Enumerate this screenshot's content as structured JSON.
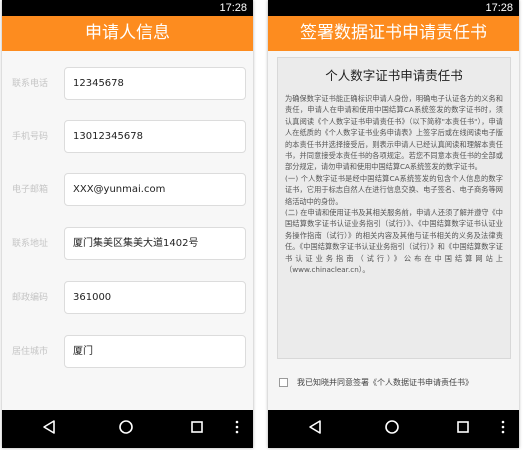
{
  "colors": {
    "accent": "#fd8c1f",
    "status_bar": "#000000",
    "nav_bar": "#000000"
  },
  "left_screen": {
    "status_time": "17:28",
    "title": "申请人信息",
    "fields": [
      {
        "label": "联系电话",
        "value": "12345678"
      },
      {
        "label": "手机号码",
        "value": "13012345678"
      },
      {
        "label": "电子邮箱",
        "value": "XXX@yunmai.com"
      },
      {
        "label": "联系地址",
        "value": "厦门集美区集美大道1402号"
      },
      {
        "label": "邮政编码",
        "value": "361000"
      },
      {
        "label": "居住城市",
        "value": "厦门"
      }
    ]
  },
  "right_screen": {
    "status_time": "17:28",
    "title": "签署数据证书申请责任书",
    "doc_title": "个人数字证书申请责任书",
    "paragraphs": [
      "为确保数字证书能正确标识申请人身份，明确电子认证各方的义务和责任，申请人在申请和使用中国结算CA系统签发的数字证书时，须认真阅读《个人数字证书申请责任书》（以下简称\"本责任书\"），申请人在纸质的《个人数字证书业务申请表》上签字后或在线阅读电子版的本责任书并选择接受后，则表示申请人已经认真阅读和理解本责任书，并同意接受本责任书的各项规定。若您不同意本责任书的全部或部分规定，请勿申请和使用中国结算CA系统签发的数字证书。",
      "(一) 个人数字证书是经中国结算CA系统签发的包含个人信息的数字证书，它用于标志自然人在进行信息交换、电子签名、电子商务等网络活动中的身份。",
      "(二) 在申请和使用证书及其相关服务前，申请人还须了解并遵守《中国结算数字证书认证业务指引（试行）》、《中国结算数字证书认证业务操作指南（试行）》的相关内容及其他与证书相关的义务及法律责任。《中国结算数字证书认证业务指引（试行）》和《中国结算数字证书认证业务指南（试行）》公布在中国结算网站上（www.chinaclear.cn）。"
    ],
    "agree_label": "我已知晓并同意签署《个人数据证书申请责任书》"
  },
  "icons": {
    "back": "back-triangle-icon",
    "home": "home-circle-icon",
    "recents": "recents-square-icon",
    "menu": "overflow-dots-icon"
  }
}
